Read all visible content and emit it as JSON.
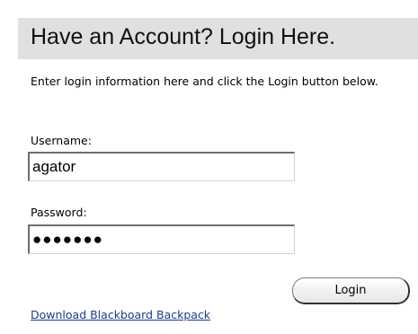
{
  "header": {
    "title": "Have an Account? Login Here."
  },
  "intro": {
    "text": "Enter login information here and click the Login button below."
  },
  "form": {
    "username_label": "Username:",
    "username_value": "agator",
    "password_label": "Password:",
    "password_mask": "●●●●●●●",
    "login_label": "Login"
  },
  "links": {
    "backpack": "Download Blackboard Backpack"
  }
}
